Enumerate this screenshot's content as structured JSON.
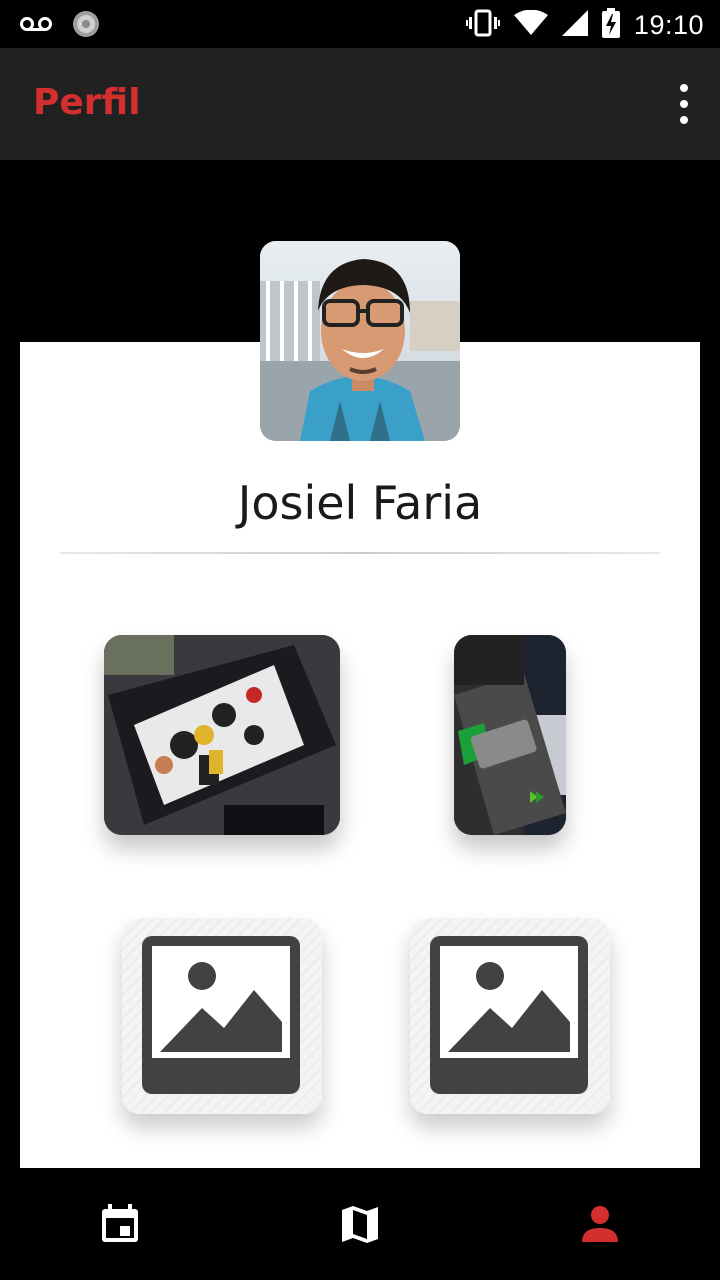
{
  "status_bar": {
    "time": "19:10",
    "icons": [
      "voicemail-icon",
      "sync-icon",
      "vibrate-icon",
      "wifi-icon",
      "signal-icon",
      "battery-charging-icon"
    ]
  },
  "app_bar": {
    "title": "Perfil",
    "overflow_icon": "more-vert-icon"
  },
  "profile": {
    "name": "Josiel Faria",
    "avatar_icon": "profile-photo"
  },
  "gallery": {
    "photos": [
      {
        "name": "artwork-photo"
      },
      {
        "name": "business-card-photo"
      }
    ],
    "placeholders": [
      {
        "name": "image-placeholder-icon"
      },
      {
        "name": "image-placeholder-icon"
      }
    ]
  },
  "bottom_nav": {
    "items": [
      {
        "icon": "calendar-event-icon",
        "active": false
      },
      {
        "icon": "map-icon",
        "active": false
      },
      {
        "icon": "person-icon",
        "active": true
      }
    ]
  },
  "colors": {
    "accent": "#d32f2f",
    "app_bar_bg": "#212121",
    "background": "#000000",
    "card": "#ffffff",
    "placeholder_icon": "#424242"
  }
}
